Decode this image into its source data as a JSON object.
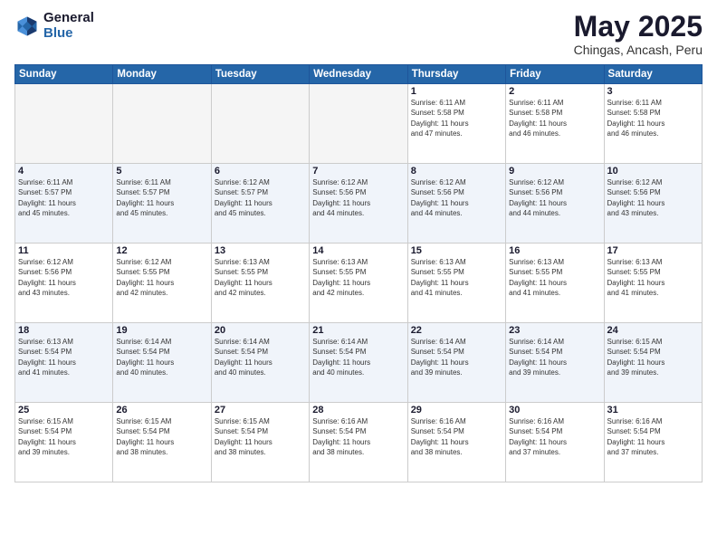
{
  "logo": {
    "general": "General",
    "blue": "Blue"
  },
  "title": "May 2025",
  "location": "Chingas, Ancash, Peru",
  "days_header": [
    "Sunday",
    "Monday",
    "Tuesday",
    "Wednesday",
    "Thursday",
    "Friday",
    "Saturday"
  ],
  "weeks": [
    [
      {
        "day": "",
        "info": ""
      },
      {
        "day": "",
        "info": ""
      },
      {
        "day": "",
        "info": ""
      },
      {
        "day": "",
        "info": ""
      },
      {
        "day": "1",
        "info": "Sunrise: 6:11 AM\nSunset: 5:58 PM\nDaylight: 11 hours\nand 47 minutes."
      },
      {
        "day": "2",
        "info": "Sunrise: 6:11 AM\nSunset: 5:58 PM\nDaylight: 11 hours\nand 46 minutes."
      },
      {
        "day": "3",
        "info": "Sunrise: 6:11 AM\nSunset: 5:58 PM\nDaylight: 11 hours\nand 46 minutes."
      }
    ],
    [
      {
        "day": "4",
        "info": "Sunrise: 6:11 AM\nSunset: 5:57 PM\nDaylight: 11 hours\nand 45 minutes."
      },
      {
        "day": "5",
        "info": "Sunrise: 6:11 AM\nSunset: 5:57 PM\nDaylight: 11 hours\nand 45 minutes."
      },
      {
        "day": "6",
        "info": "Sunrise: 6:12 AM\nSunset: 5:57 PM\nDaylight: 11 hours\nand 45 minutes."
      },
      {
        "day": "7",
        "info": "Sunrise: 6:12 AM\nSunset: 5:56 PM\nDaylight: 11 hours\nand 44 minutes."
      },
      {
        "day": "8",
        "info": "Sunrise: 6:12 AM\nSunset: 5:56 PM\nDaylight: 11 hours\nand 44 minutes."
      },
      {
        "day": "9",
        "info": "Sunrise: 6:12 AM\nSunset: 5:56 PM\nDaylight: 11 hours\nand 44 minutes."
      },
      {
        "day": "10",
        "info": "Sunrise: 6:12 AM\nSunset: 5:56 PM\nDaylight: 11 hours\nand 43 minutes."
      }
    ],
    [
      {
        "day": "11",
        "info": "Sunrise: 6:12 AM\nSunset: 5:56 PM\nDaylight: 11 hours\nand 43 minutes."
      },
      {
        "day": "12",
        "info": "Sunrise: 6:12 AM\nSunset: 5:55 PM\nDaylight: 11 hours\nand 42 minutes."
      },
      {
        "day": "13",
        "info": "Sunrise: 6:13 AM\nSunset: 5:55 PM\nDaylight: 11 hours\nand 42 minutes."
      },
      {
        "day": "14",
        "info": "Sunrise: 6:13 AM\nSunset: 5:55 PM\nDaylight: 11 hours\nand 42 minutes."
      },
      {
        "day": "15",
        "info": "Sunrise: 6:13 AM\nSunset: 5:55 PM\nDaylight: 11 hours\nand 41 minutes."
      },
      {
        "day": "16",
        "info": "Sunrise: 6:13 AM\nSunset: 5:55 PM\nDaylight: 11 hours\nand 41 minutes."
      },
      {
        "day": "17",
        "info": "Sunrise: 6:13 AM\nSunset: 5:55 PM\nDaylight: 11 hours\nand 41 minutes."
      }
    ],
    [
      {
        "day": "18",
        "info": "Sunrise: 6:13 AM\nSunset: 5:54 PM\nDaylight: 11 hours\nand 41 minutes."
      },
      {
        "day": "19",
        "info": "Sunrise: 6:14 AM\nSunset: 5:54 PM\nDaylight: 11 hours\nand 40 minutes."
      },
      {
        "day": "20",
        "info": "Sunrise: 6:14 AM\nSunset: 5:54 PM\nDaylight: 11 hours\nand 40 minutes."
      },
      {
        "day": "21",
        "info": "Sunrise: 6:14 AM\nSunset: 5:54 PM\nDaylight: 11 hours\nand 40 minutes."
      },
      {
        "day": "22",
        "info": "Sunrise: 6:14 AM\nSunset: 5:54 PM\nDaylight: 11 hours\nand 39 minutes."
      },
      {
        "day": "23",
        "info": "Sunrise: 6:14 AM\nSunset: 5:54 PM\nDaylight: 11 hours\nand 39 minutes."
      },
      {
        "day": "24",
        "info": "Sunrise: 6:15 AM\nSunset: 5:54 PM\nDaylight: 11 hours\nand 39 minutes."
      }
    ],
    [
      {
        "day": "25",
        "info": "Sunrise: 6:15 AM\nSunset: 5:54 PM\nDaylight: 11 hours\nand 39 minutes."
      },
      {
        "day": "26",
        "info": "Sunrise: 6:15 AM\nSunset: 5:54 PM\nDaylight: 11 hours\nand 38 minutes."
      },
      {
        "day": "27",
        "info": "Sunrise: 6:15 AM\nSunset: 5:54 PM\nDaylight: 11 hours\nand 38 minutes."
      },
      {
        "day": "28",
        "info": "Sunrise: 6:16 AM\nSunset: 5:54 PM\nDaylight: 11 hours\nand 38 minutes."
      },
      {
        "day": "29",
        "info": "Sunrise: 6:16 AM\nSunset: 5:54 PM\nDaylight: 11 hours\nand 38 minutes."
      },
      {
        "day": "30",
        "info": "Sunrise: 6:16 AM\nSunset: 5:54 PM\nDaylight: 11 hours\nand 37 minutes."
      },
      {
        "day": "31",
        "info": "Sunrise: 6:16 AM\nSunset: 5:54 PM\nDaylight: 11 hours\nand 37 minutes."
      }
    ]
  ]
}
